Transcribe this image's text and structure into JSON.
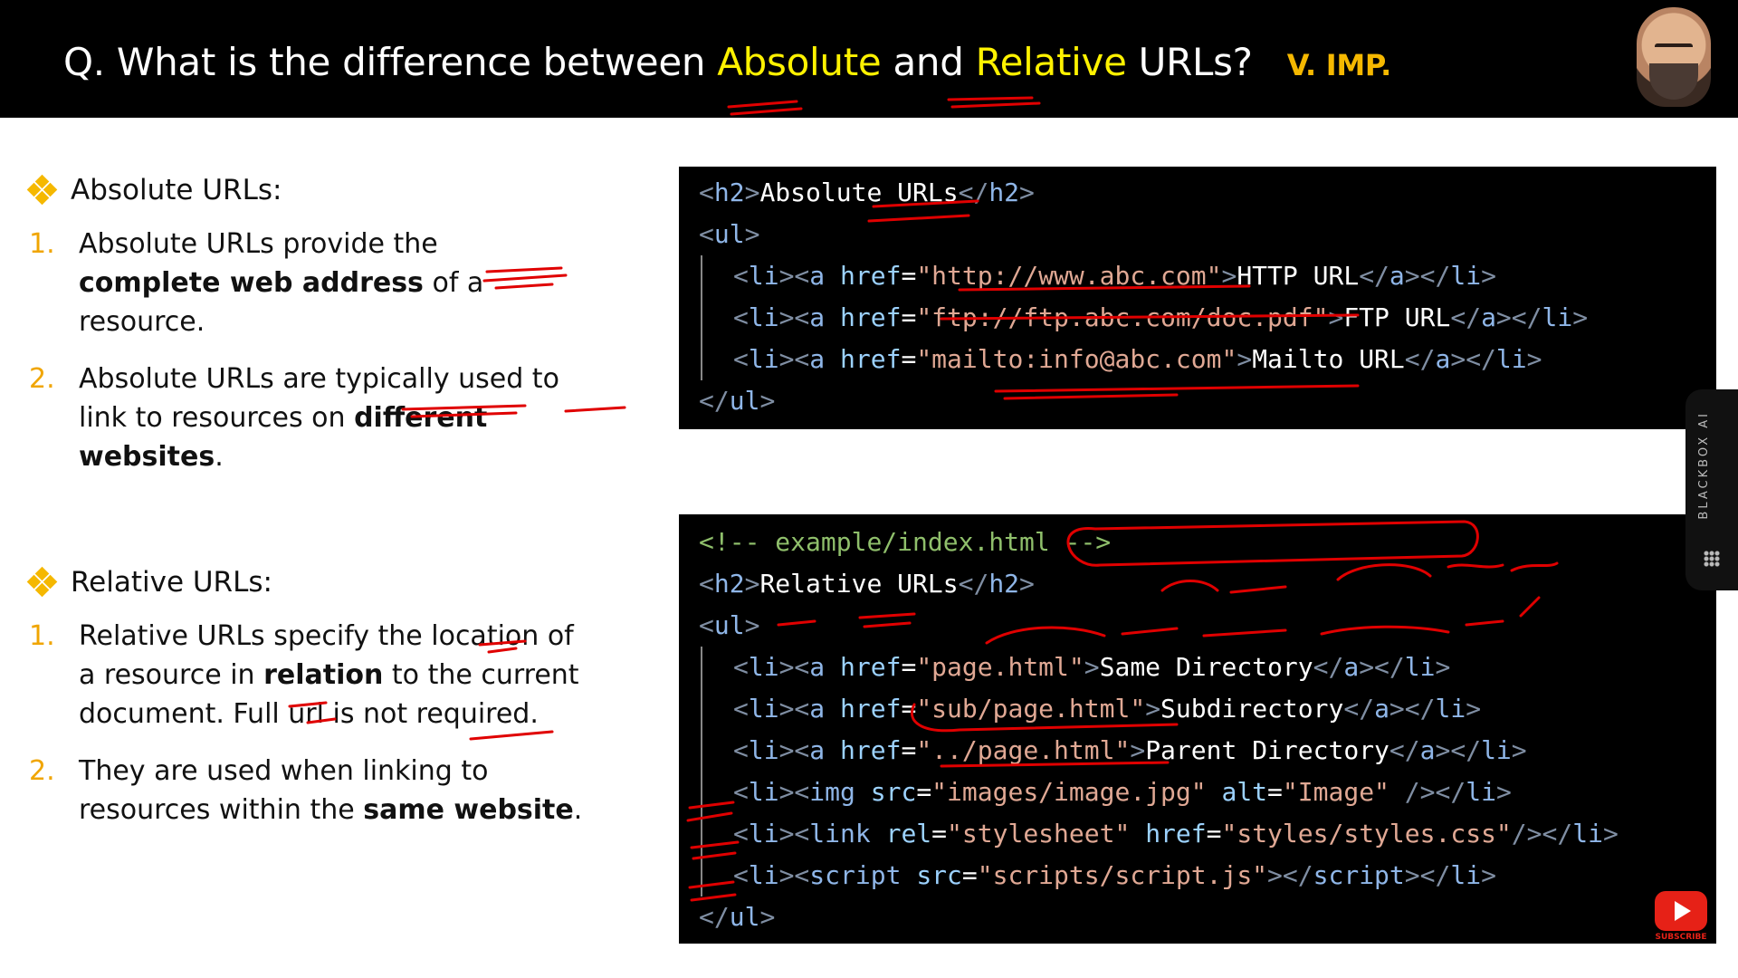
{
  "header": {
    "title_prefix": "Q. What is the difference between ",
    "title_abs": "Absolute",
    "title_and": " and ",
    "title_rel": "Relative",
    "title_suffix": " URLs?",
    "badge": "V. IMP."
  },
  "absolute": {
    "heading": "Absolute URLs:",
    "items": [
      {
        "num": "1.",
        "p1": "Absolute URLs provide the ",
        "b1": "complete web address",
        "p2": " of a resource."
      },
      {
        "num": "2.",
        "p1": "Absolute URLs  are typically used to link to resources on ",
        "b1": "different websites",
        "p2": "."
      }
    ]
  },
  "relative": {
    "heading": "Relative URLs:",
    "items": [
      {
        "num": "1.",
        "p1": "Relative URLs specify the location of a resource in ",
        "b1": "relation",
        "p2": " to the current document. Full url is not required."
      },
      {
        "num": "2.",
        "p1": "They are used when linking to resources within the ",
        "b1": "same website",
        "p2": "."
      }
    ]
  },
  "code_abs": {
    "h2_text": "Absolute URLs",
    "links": [
      {
        "href": "\"http://www.abc.com\"",
        "text": "HTTP URL"
      },
      {
        "href": "\"ftp://ftp.abc.com/doc.pdf\"",
        "text": "FTP URL"
      },
      {
        "href": "\"mailto:info@abc.com\"",
        "text": "Mailto URL"
      }
    ]
  },
  "code_rel": {
    "comment": "example/index.html",
    "h2_text": "Relative URLs",
    "links": [
      {
        "href": "\"page.html\"",
        "text": "Same Directory"
      },
      {
        "href": "\"sub/page.html\"",
        "text": "Subdirectory"
      },
      {
        "href": "\"../page.html\"",
        "text": "Parent Directory"
      }
    ],
    "img_src": "\"images/image.jpg\"",
    "img_alt": "\"Image\"",
    "link_rel": "\"stylesheet\"",
    "link_href": "\"styles/styles.css\"",
    "script_src": "\"scripts/script.js\""
  },
  "side_tab": {
    "label": "BLACKBOX AI"
  },
  "youtube": {
    "caption": "SUBSCRIBE"
  },
  "colors": {
    "accent_yellow": "#fff200",
    "badge": "#f5b800",
    "ink": "#e00000"
  }
}
